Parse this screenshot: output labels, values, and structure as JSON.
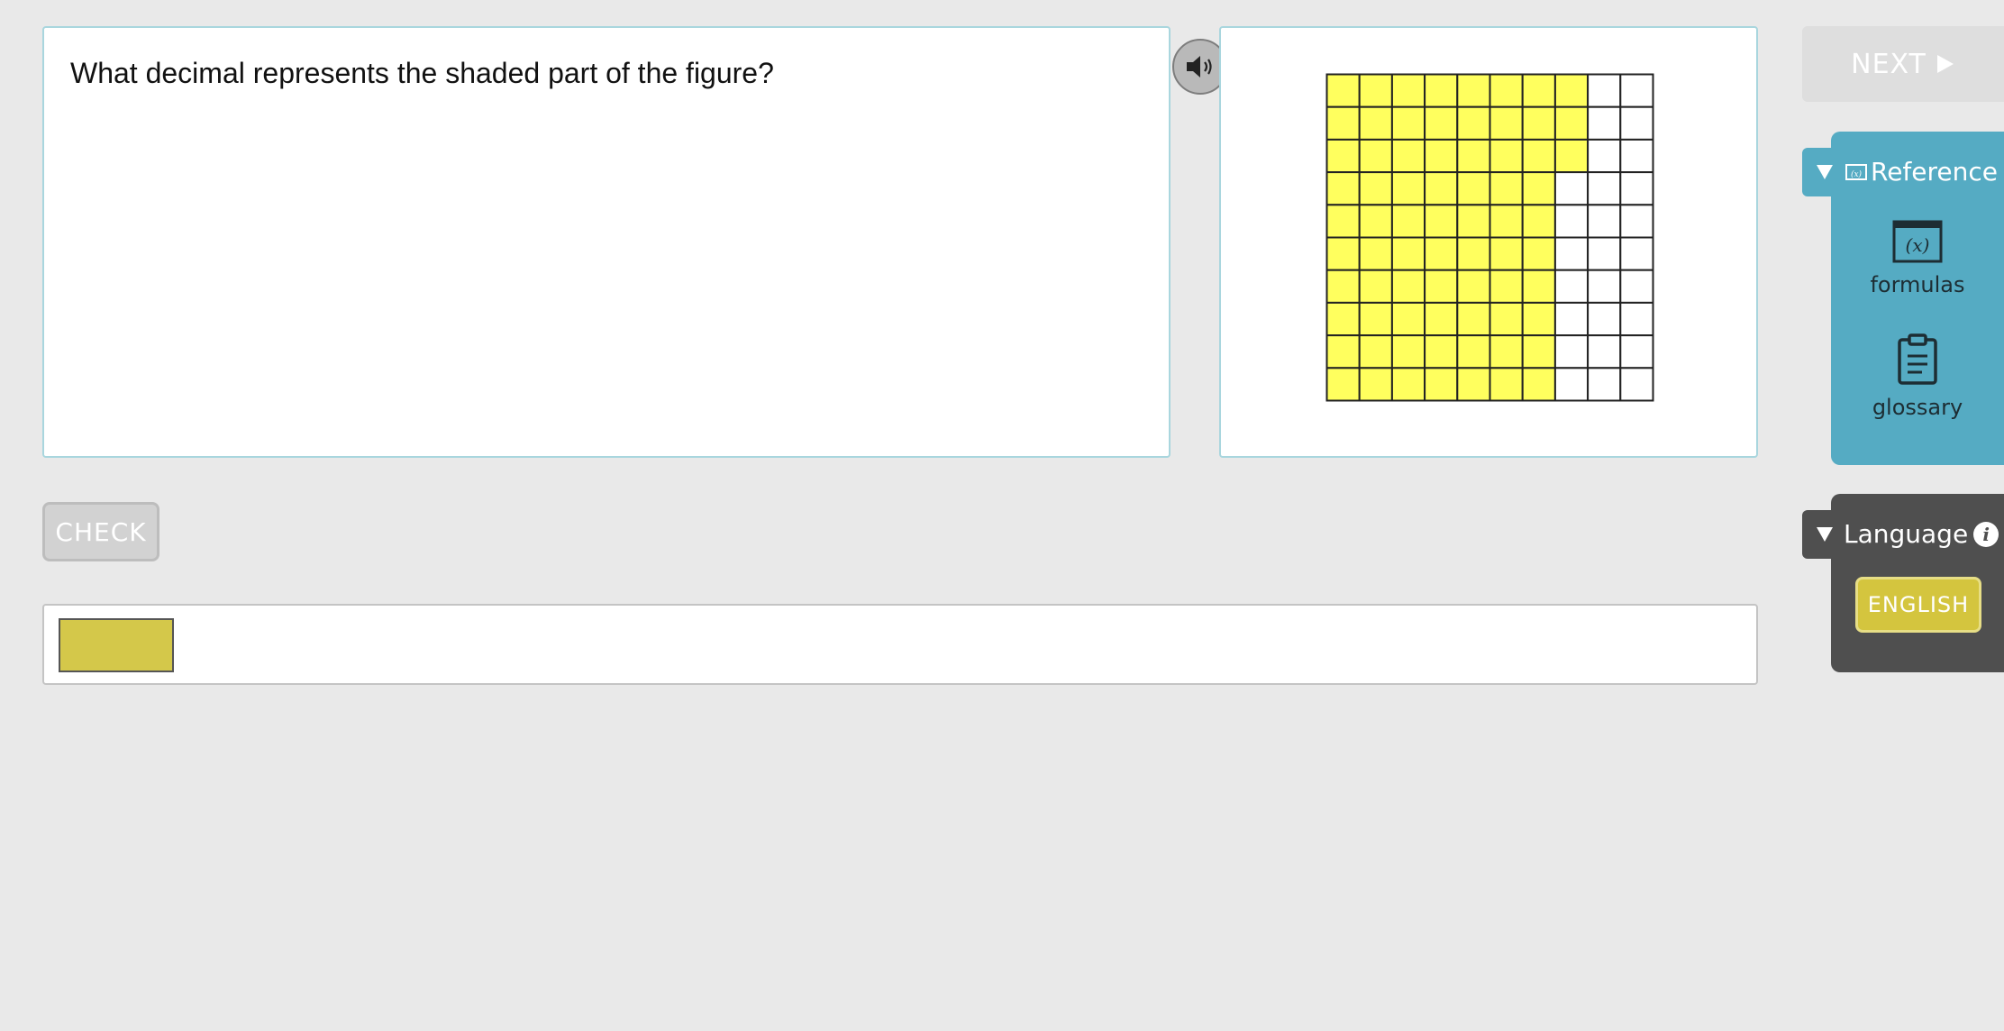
{
  "question": {
    "text": "What decimal represents the shaded part of the figure?"
  },
  "figure": {
    "grid_rows": 10,
    "grid_cols": 10,
    "shaded_count": 73,
    "shaded_color": "#ffff5e",
    "unshaded_color": "#ffffff",
    "line_color": "#222222"
  },
  "actions": {
    "check_label": "CHECK",
    "next_label": "NEXT"
  },
  "answer": {
    "value": ""
  },
  "reference": {
    "title": "Reference",
    "items": [
      {
        "label": "formulas",
        "icon": "formula-icon"
      },
      {
        "label": "glossary",
        "icon": "clipboard-icon"
      }
    ]
  },
  "language": {
    "title": "Language",
    "selected": "ENGLISH"
  },
  "colors": {
    "reference_panel": "#55abc3",
    "language_panel": "#4f4f4f",
    "answer_box": "#d4c84a",
    "panel_border": "#a9d6de"
  }
}
